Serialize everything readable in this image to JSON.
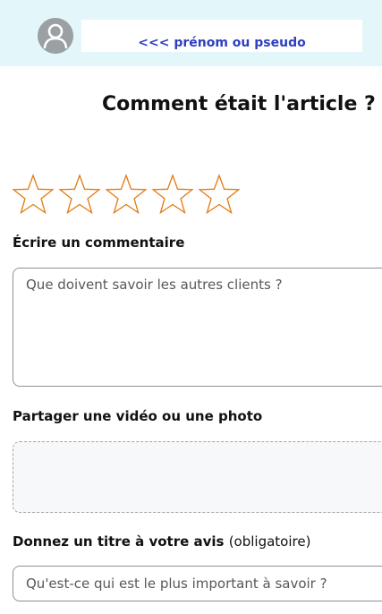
{
  "header": {
    "avatar_icon": "user-avatar-icon",
    "name_field": {
      "value": "<<< prénom ou pseudo",
      "color": "#2e3fbf"
    },
    "background": "#e3f7fa"
  },
  "page_title": "Comment était l'article ?",
  "rating": {
    "icon": "star-outline-icon",
    "star_color": "#e47911",
    "max": 5,
    "selected": 0
  },
  "comment": {
    "label": "Écrire un commentaire",
    "placeholder": "Que doivent savoir les autres clients ?",
    "value": ""
  },
  "media": {
    "label": "Partager une vidéo ou une photo"
  },
  "review_title": {
    "label": "Donnez un titre à votre avis",
    "note": "(obligatoire)",
    "placeholder": "Qu'est-ce qui est le plus important à savoir ?",
    "value": ""
  }
}
